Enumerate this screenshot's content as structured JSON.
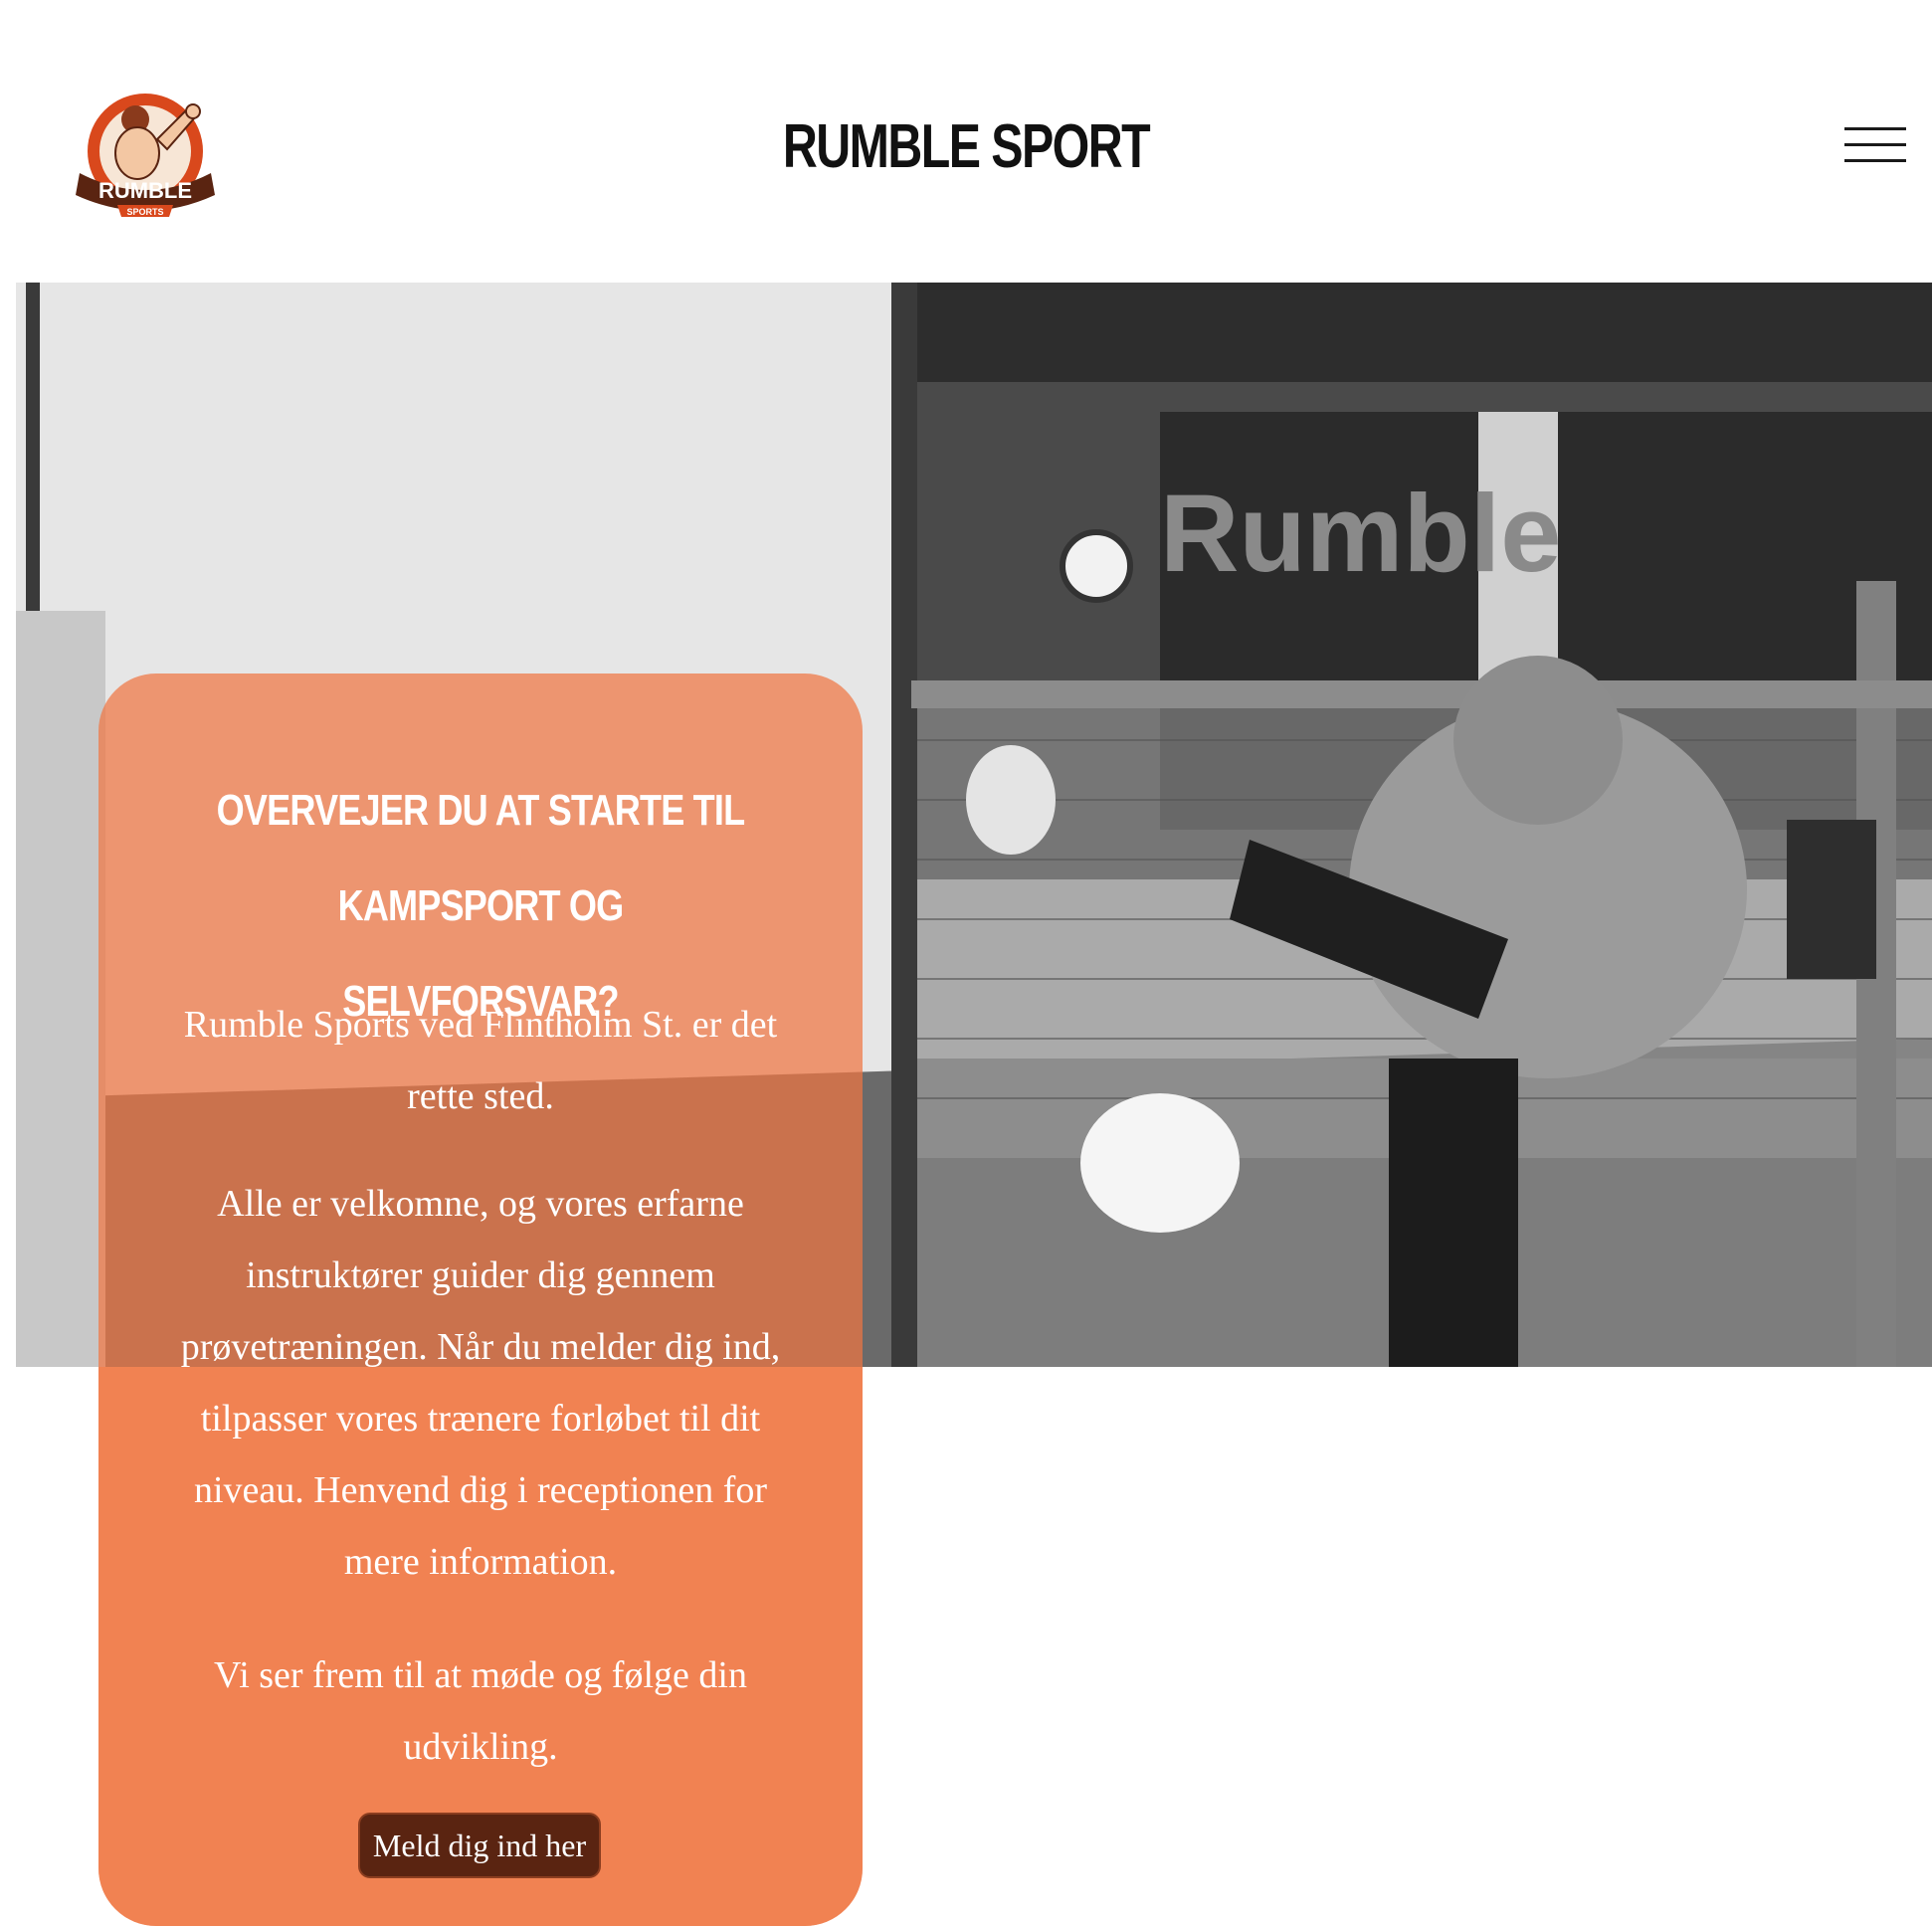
{
  "header": {
    "site_title": "RUMBLE SPORT",
    "logo": {
      "icon": "rumble-sports-logo",
      "banner_text": "RUMBLE",
      "sub_text": "SPORTS"
    },
    "menu_icon": "hamburger-menu-icon"
  },
  "hero": {
    "image": "gym-kickboxing-training-photo",
    "wall_lettering": "Rumble"
  },
  "card": {
    "heading": "OVERVEJER DU AT STARTE TIL KAMPSPORT OG SELVFORSVAR?",
    "paragraph_1": "Rumble Sports ved Flintholm St. er det rette sted.",
    "paragraph_2": "Alle er velkomne, og vores erfarne instruktører guider dig gennem prøvetræningen. Når du melder dig ind, tilpasser vores trænere forløbet til dit niveau. Henvend dig i receptionen for mere information.",
    "paragraph_3": "Vi ser frem til at møde og følge din udvikling.",
    "cta_label": "Meld dig ind her"
  },
  "colors": {
    "card_overlay": "#f07642",
    "card_solid": "#f4a07a",
    "cta_background": "#5a2411",
    "title": "#111111"
  }
}
